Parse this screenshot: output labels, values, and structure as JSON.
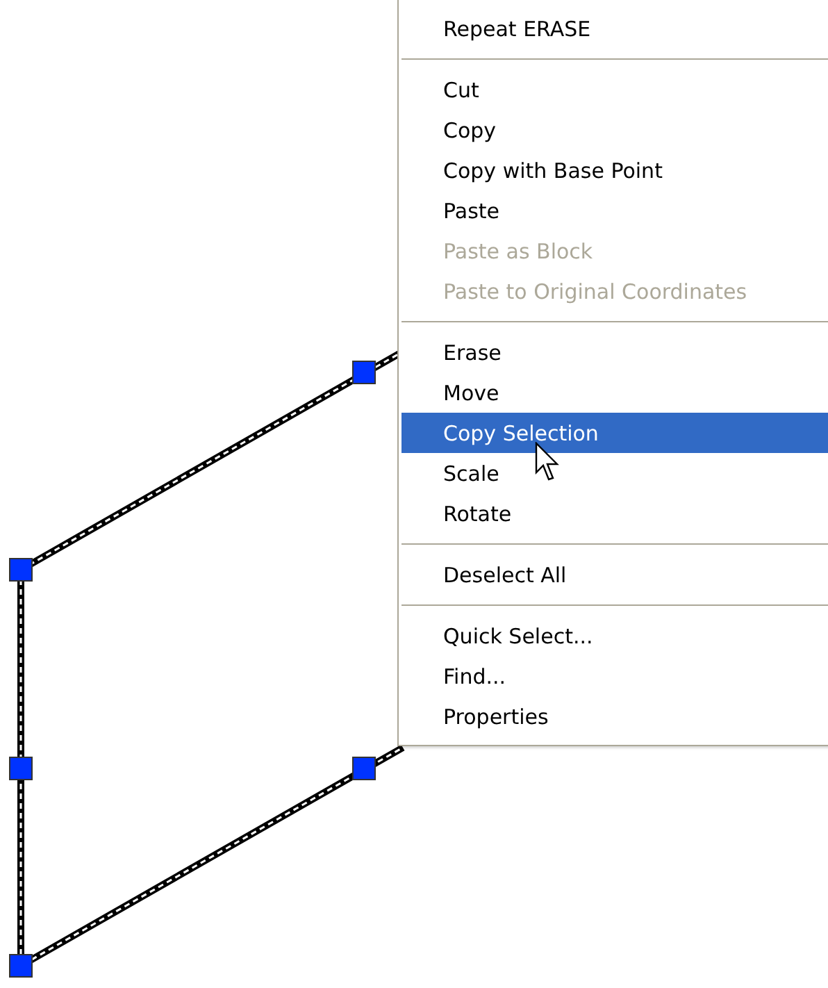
{
  "drawing": {
    "kind": "polyline"
  },
  "context_menu": {
    "groups": [
      [
        {
          "label": "Repeat ERASE",
          "disabled": false,
          "selected": false
        }
      ],
      [
        {
          "label": "Cut",
          "disabled": false,
          "selected": false
        },
        {
          "label": "Copy",
          "disabled": false,
          "selected": false
        },
        {
          "label": "Copy with Base Point",
          "disabled": false,
          "selected": false
        },
        {
          "label": "Paste",
          "disabled": false,
          "selected": false
        },
        {
          "label": "Paste as Block",
          "disabled": true,
          "selected": false
        },
        {
          "label": "Paste to Original Coordinates",
          "disabled": true,
          "selected": false
        }
      ],
      [
        {
          "label": "Erase",
          "disabled": false,
          "selected": false
        },
        {
          "label": "Move",
          "disabled": false,
          "selected": false
        },
        {
          "label": "Copy Selection",
          "disabled": false,
          "selected": true
        },
        {
          "label": "Scale",
          "disabled": false,
          "selected": false
        },
        {
          "label": "Rotate",
          "disabled": false,
          "selected": false
        }
      ],
      [
        {
          "label": "Deselect All",
          "disabled": false,
          "selected": false
        }
      ],
      [
        {
          "label": "Quick Select...",
          "disabled": false,
          "selected": false
        },
        {
          "label": "Find...",
          "disabled": false,
          "selected": false
        },
        {
          "label": "Properties",
          "disabled": false,
          "selected": false
        }
      ]
    ]
  }
}
